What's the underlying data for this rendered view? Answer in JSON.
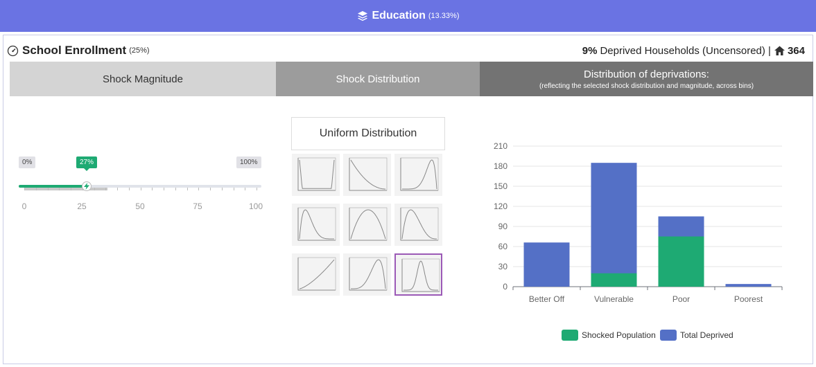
{
  "header": {
    "title": "Education",
    "percent": "(13.33%)",
    "icon": "layers-icon"
  },
  "indicator": {
    "title": "School Enrollment",
    "percent": "(25%)",
    "icon": "gauge-icon",
    "deprived_pct": "9%",
    "deprived_text": "Deprived Households (Uncensored) |",
    "home_icon": "home-icon",
    "household_count": "364"
  },
  "tabs": {
    "magnitude": "Shock Magnitude",
    "distribution": "Shock Distribution",
    "deprivations_title": "Distribution of deprivations:",
    "deprivations_sub": "(reflecting the selected shock distribution and magnitude, across bins)"
  },
  "slider": {
    "min_label": "0%",
    "max_label": "100%",
    "value_label": "27%",
    "value": 27,
    "handle_icon": "bolt-icon",
    "scale": [
      "0",
      "25",
      "50",
      "75",
      "100"
    ]
  },
  "distribution": {
    "selected_label": "Uniform Distribution",
    "thumbnails": [
      {
        "shape": "u-shape"
      },
      {
        "shape": "decreasing"
      },
      {
        "shape": "right-peak"
      },
      {
        "shape": "left-skew-peak"
      },
      {
        "shape": "symmetric-arc"
      },
      {
        "shape": "left-peak"
      },
      {
        "shape": "increasing"
      },
      {
        "shape": "right-skew-peak"
      },
      {
        "shape": "bell",
        "selected": true
      }
    ]
  },
  "colors": {
    "accent": "#6a73e3",
    "shocked": "#1eaa73",
    "total": "#5470c6"
  },
  "chart_data": {
    "type": "bar",
    "stacked": true,
    "categories": [
      "Better Off",
      "Vulnerable",
      "Poor",
      "Poorest"
    ],
    "series": [
      {
        "name": "Shocked Population",
        "values": [
          0,
          20,
          75,
          0
        ]
      },
      {
        "name": "Total Deprived",
        "values": [
          66,
          185,
          105,
          4
        ]
      }
    ],
    "yticks": [
      "0",
      "30",
      "60",
      "90",
      "120",
      "150",
      "180",
      "210"
    ],
    "ylim": [
      0,
      210
    ],
    "grid": true,
    "legend": "bottom"
  }
}
